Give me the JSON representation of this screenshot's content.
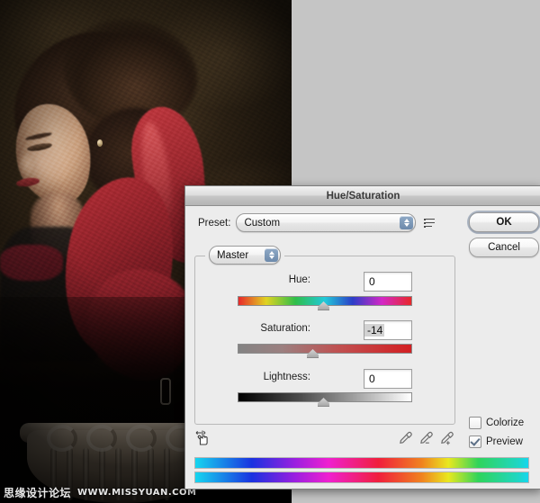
{
  "dialog": {
    "title": "Hue/Saturation",
    "preset": {
      "label": "Preset:",
      "value": "Custom",
      "menu_icon": "preset-menu-icon"
    },
    "buttons": {
      "ok": "OK",
      "cancel": "Cancel"
    },
    "channel": {
      "value": "Master"
    },
    "sliders": [
      {
        "label": "Hue:",
        "value": "0",
        "selected": false,
        "thumb_percent": 50,
        "track": "hue-rainbow"
      },
      {
        "label": "Saturation:",
        "value": "-14",
        "selected": true,
        "thumb_percent": 43,
        "track": "gray-to-red"
      },
      {
        "label": "Lightness:",
        "value": "0",
        "selected": false,
        "thumb_percent": 50,
        "track": "black-to-white"
      }
    ],
    "tools": {
      "scrub_icon": "scrubby-hand-icon",
      "eyedroppers": [
        "eyedropper-icon",
        "eyedropper-minus-icon",
        "eyedropper-plus-icon"
      ]
    },
    "checkboxes": [
      {
        "label": "Colorize",
        "checked": false
      },
      {
        "label": "Preview",
        "checked": true
      }
    ],
    "spectrum_bars": 2,
    "colors": {
      "dialog_bg": "#ececec",
      "title_text": "#3b3b3b",
      "stepper_blue": "#7a94b4",
      "check_mark": "#5c6f86",
      "selection_gray": "#d2d2d2"
    }
  },
  "canvas": {
    "background_color": "#c5c5c5",
    "photo_alt": "portrait-of-woman-with-red-gloves"
  },
  "watermark": {
    "cn": "思缘设计论坛",
    "url": "WWW.MISSYUAN.COM"
  }
}
